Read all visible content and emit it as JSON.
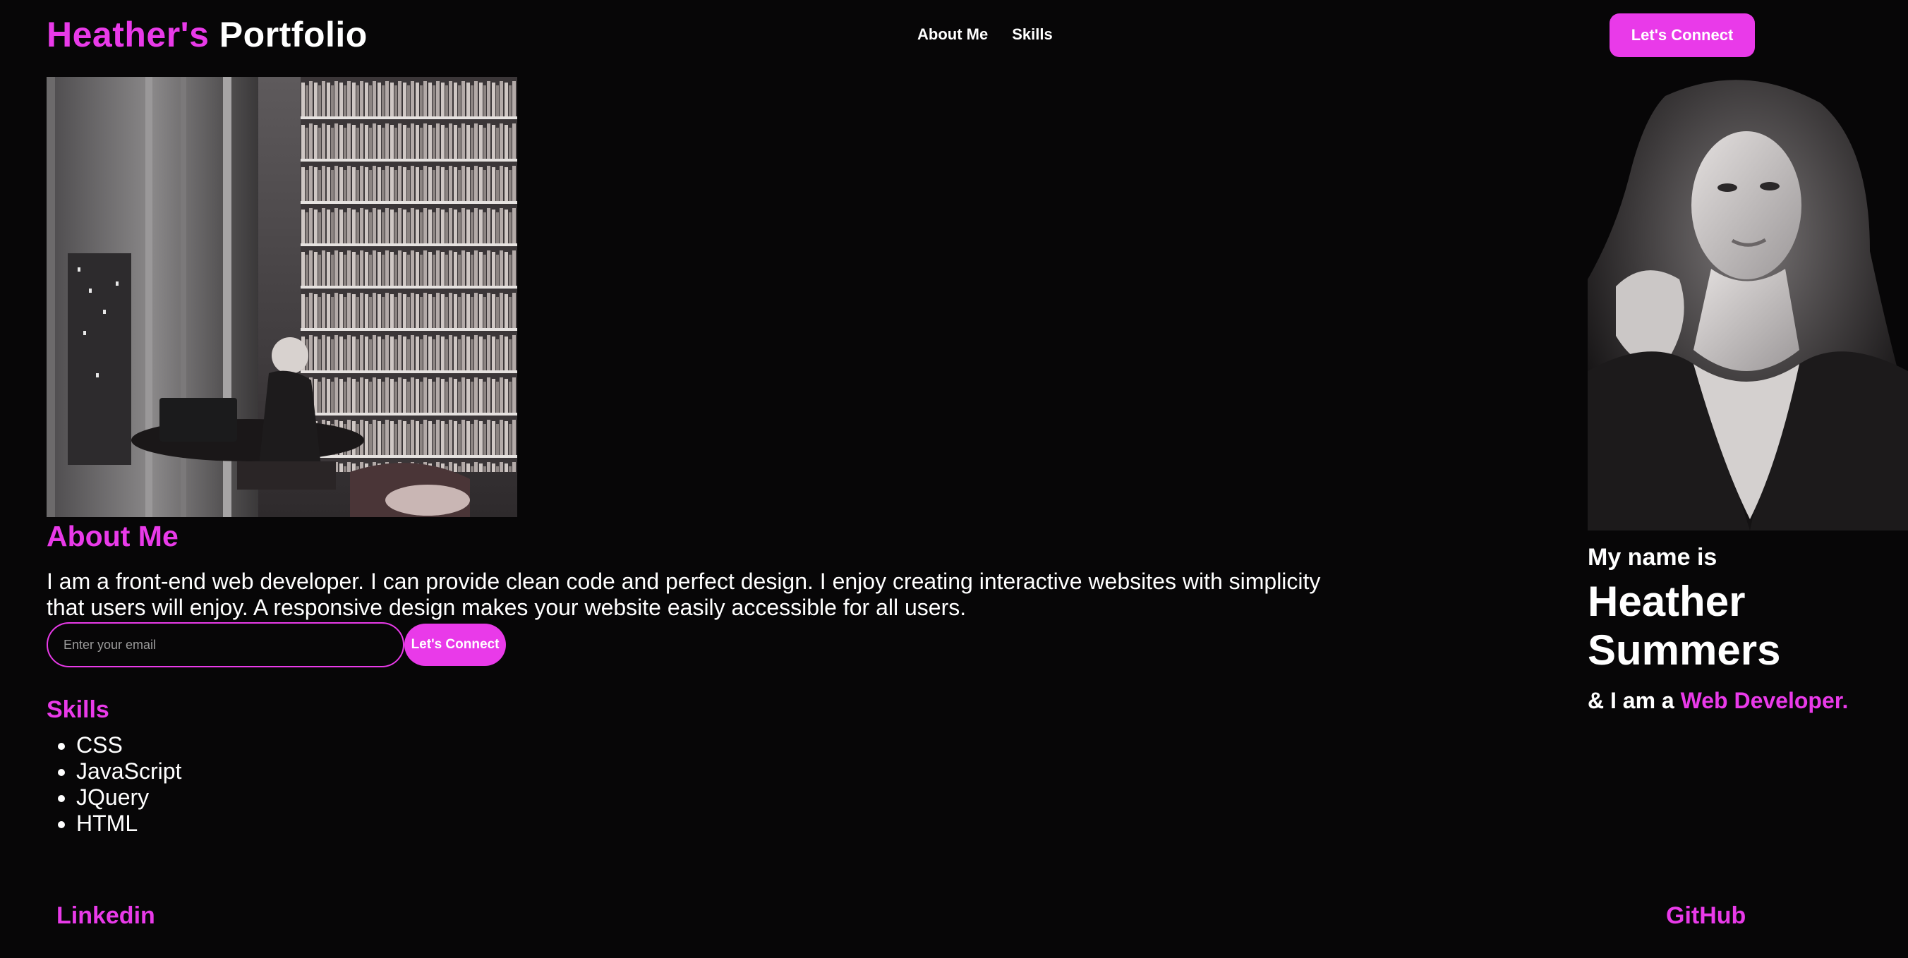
{
  "header": {
    "brand_accent": "Heather's",
    "brand_rest": "Portfolio",
    "nav": [
      {
        "label": "About Me"
      },
      {
        "label": "Skills"
      }
    ],
    "connect_label": "Let's Connect"
  },
  "about": {
    "heading": "About Me",
    "text": "I am a front-end web developer. I can provide clean code and perfect design. I enjoy creating interactive websites with simplicity that users will enjoy. A responsive design makes your website easily accessible for all users."
  },
  "email_form": {
    "placeholder": "Enter your email",
    "value": "",
    "button_label": "Let's Connect"
  },
  "skills": {
    "heading": "Skills",
    "items": [
      "CSS",
      "JavaScript",
      "JQuery",
      "HTML"
    ]
  },
  "intro": {
    "greeting": "My name is",
    "name": "Heather Summers",
    "role_prefix": "& I am a",
    "role_accent": "Web Developer."
  },
  "footer": {
    "linkedin": "Linkedin",
    "github": "GitHub"
  },
  "colors": {
    "background": "#070607",
    "accent": "#e93ae9",
    "text": "#ffffff"
  }
}
